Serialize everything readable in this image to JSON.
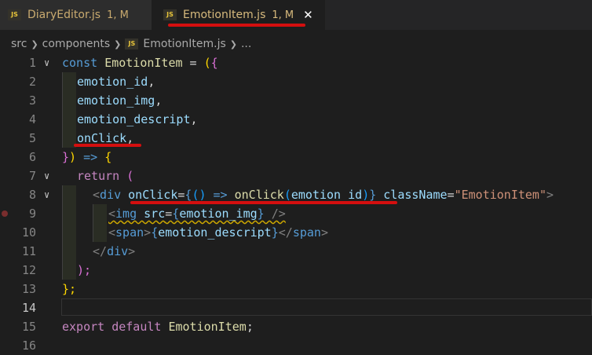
{
  "tabs": [
    {
      "icon": "JS",
      "name": "DiaryEditor.js",
      "status": "1, M"
    },
    {
      "icon": "JS",
      "name": "EmotionItem.js",
      "status": "1, M",
      "close": "✕"
    }
  ],
  "breadcrumb": {
    "items": [
      "src",
      "components"
    ],
    "file_icon": "JS",
    "file": "EmotionItem.js",
    "more": "..."
  },
  "line_numbers": [
    "1",
    "2",
    "3",
    "4",
    "5",
    "6",
    "7",
    "8",
    "9",
    "10",
    "11",
    "12",
    "13",
    "14",
    "15",
    "16"
  ],
  "code": {
    "l1": {
      "kw": "const",
      "name": "EmotionItem",
      "op": " = ",
      "paren": "(",
      "brace": "{"
    },
    "l2": {
      "text": "emotion_id",
      "comma": ","
    },
    "l3": {
      "text": "emotion_img",
      "comma": ","
    },
    "l4": {
      "text": "emotion_descript",
      "comma": ","
    },
    "l5": {
      "text": "onClick",
      "comma": ","
    },
    "l6": {
      "brace": "}",
      "paren": ")",
      "arrow": " => ",
      "open": "{"
    },
    "l7": {
      "kw": "return",
      "paren": " ("
    },
    "l8": {
      "lt": "<",
      "tag": "div",
      "attr": "onClick",
      "eq": "=",
      "ob": "{",
      "pp": "()",
      "arrow": " => ",
      "fn": "onClick",
      "op": "(",
      "arg": "emotion_id",
      "cp": ")",
      "cb": "}",
      "attr2": "className",
      "eq2": "=",
      "str": "\"EmotionItem\"",
      "gt": ">"
    },
    "l9": {
      "lt": "<",
      "tag": "img",
      "attr": "src",
      "eq": "=",
      "ob": "{",
      "val": "emotion_img",
      "cb": "}",
      "end": " />"
    },
    "l10": {
      "lt": "<",
      "tag": "span",
      "gt": ">",
      "ob": "{",
      "val": "emotion_descript",
      "cb": "}",
      "close_lt": "</",
      "gt2": ">"
    },
    "l11": {
      "lt": "</",
      "tag": "div",
      "gt": ">"
    },
    "l12": {
      "text": ");"
    },
    "l13": {
      "text": "};"
    },
    "l15": {
      "kw": "export",
      "kw2": "default",
      "name": "EmotionItem",
      "semi": ";"
    }
  },
  "colors": {
    "annotation_red": "#d40f0f",
    "js_icon": "#e8c53a",
    "modified": "#d7ba7d"
  }
}
